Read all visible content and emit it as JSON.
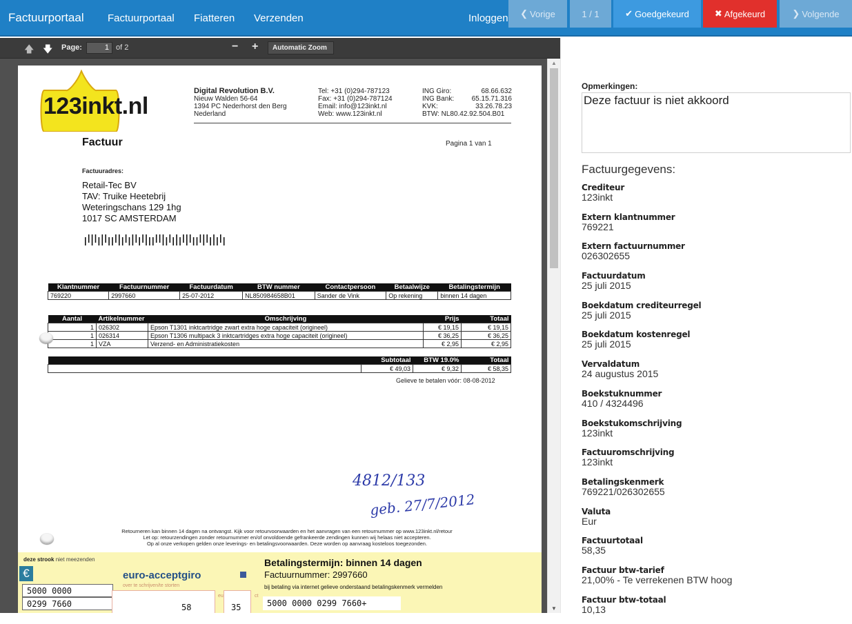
{
  "navbar": {
    "brand": "Factuurportaal",
    "links": [
      "Factuurportaal",
      "Fiatteren",
      "Verzenden"
    ],
    "login": "Inloggen",
    "prev_label": "Vorige",
    "counter": "1 / 1",
    "approved_label": "Goedgekeurd",
    "rejected_label": "Afgekeurd",
    "next_label": "Volgende",
    "colors": {
      "bar": "#1f80c6",
      "approve": "#3d9ae0",
      "reject": "#e1302c",
      "disabled": "#6da9d6"
    }
  },
  "pdf_toolbar": {
    "page_label": "Page:",
    "page_value": "1",
    "page_total": "of 2",
    "zoom_out": "−",
    "zoom_in": "+",
    "zoom_select": "Automatic Zoom"
  },
  "document": {
    "logo_text": "123inkt.nl",
    "company": {
      "name": "Digital Revolution B.V.",
      "lines": [
        "Nieuw Walden 56-64",
        "1394 PC Nederhorst den Berg",
        "Nederland"
      ]
    },
    "contact": [
      "Tel:  +31 (0)294-787123",
      "Fax: +31 (0)294-787124",
      "Email:   info@123inkt.nl",
      "Web:      www.123inkt.nl"
    ],
    "bank": [
      {
        "k": "ING Giro:",
        "v": "68.66.632"
      },
      {
        "k": "ING Bank:",
        "v": "65.15.71.316"
      },
      {
        "k": "KVK:",
        "v": "33.26.78.23"
      },
      {
        "k": "BTW: NL80.42.92.504.B01",
        "v": ""
      }
    ],
    "title": "Factuur",
    "pagina": "Pagina 1 van 1",
    "addr_label": "Factuuradres:",
    "address": [
      "Retail-Tec BV",
      "TAV: Truike Heetebrij",
      "Weteringschans 129 1hg",
      "1017 SC  AMSTERDAM"
    ],
    "info_headers": [
      "Klantnummer",
      "Factuurnummer",
      "Factuurdatum",
      "BTW nummer",
      "Contactpersoon",
      "Betaalwijze",
      "Betalingstermijn"
    ],
    "info_values": [
      "769220",
      "2997660",
      "25-07-2012",
      "NL850984658B01",
      "Sander de Vink",
      "Op rekening",
      "binnen 14 dagen"
    ],
    "item_headers": [
      "Aantal",
      "Artikelnummer",
      "Omschrijving",
      "Prijs",
      "Totaal"
    ],
    "items": [
      {
        "aantal": "1",
        "art": "026302",
        "omschr": "Epson T1301 inktcartridge zwart extra hoge capaciteit (origineel)",
        "prijs": "€ 19,15",
        "totaal": "€ 19,15"
      },
      {
        "aantal": "1",
        "art": "026314",
        "omschr": "Epson T1306 multipack 3 inktcartridges extra hoge capaciteit (origineel)",
        "prijs": "€ 36,25",
        "totaal": "€ 36,25"
      },
      {
        "aantal": "1",
        "art": "VZA",
        "omschr": "Verzend- en Administratiekosten",
        "prijs": "€ 2,95",
        "totaal": "€ 2,95"
      }
    ],
    "sum_headers": [
      "Subtotaal",
      "BTW 19.0%",
      "Totaal"
    ],
    "sum_values": [
      "€ 49,03",
      "€ 9,32",
      "€ 58,35"
    ],
    "gelieve": "Gelieve te betalen vóór:  08-08-2012",
    "handwriting_1": "4812/133",
    "handwriting_2": "geb. 27/7/2012",
    "footer_lines": [
      "Retourneren kan binnen 14 dagen na ontvangst. Kijk voor retourvoorwaarden en het aanvragen van een retournummer op www.123inkt.nl/retour",
      "Let op: retourzendingen zonder retournummer en/of onvoldoende gefrankeerde zendingen kunnen wij helaas niet accepteren.",
      "Op al onze verkopen gelden onze leverings- en betalingsvoorwaarden. Deze worden op aanvraag kosteloos toegezonden."
    ],
    "strip": {
      "note_bold": "deze strook",
      "note_rest": " niet meezenden",
      "euro": "€",
      "acceptgiro_title": "euro-acceptgiro",
      "acceptgiro_sub": "over te schrijven/te storten",
      "box1": "5000 0000",
      "box2": "0299 7660",
      "amount_euro": "58",
      "amount_cents": "35",
      "euro_label": "euro",
      "ct_label": "ct",
      "bt_title": "Betalingstermijn: binnen 14 dagen",
      "bt_num": "Factuurnummer: 2997660",
      "bt_small": "bij betaling via internet gelieve onderstaand betalingskenmerk vermelden",
      "bt_kenmerk": "5000 0000 0299 7660+"
    }
  },
  "panel": {
    "remarks_label": "Opmerkingen:",
    "remarks_value": "Deze factuur is niet akkoord",
    "section_title": "Factuurgegevens:",
    "fields": [
      {
        "k": "Crediteur",
        "v": "123inkt"
      },
      {
        "k": "Extern klantnummer",
        "v": "769221"
      },
      {
        "k": "Extern factuurnummer",
        "v": "026302655"
      },
      {
        "k": "Factuurdatum",
        "v": "25 juli 2015"
      },
      {
        "k": "Boekdatum crediteurregel",
        "v": "25 juli 2015"
      },
      {
        "k": "Boekdatum kostenregel",
        "v": "25 juli 2015"
      },
      {
        "k": "Vervaldatum",
        "v": "24 augustus 2015"
      },
      {
        "k": "Boekstuknummer",
        "v": "410 / 4324496"
      },
      {
        "k": "Boekstukomschrijving",
        "v": "123inkt"
      },
      {
        "k": "Factuuromschrijving",
        "v": "123inkt"
      },
      {
        "k": "Betalingskenmerk",
        "v": "769221/026302655"
      },
      {
        "k": "Valuta",
        "v": "Eur"
      },
      {
        "k": "Factuurtotaal",
        "v": "58,35"
      },
      {
        "k": "Factuur btw-tarief",
        "v": "21,00% -  Te verrekenen BTW hoog"
      },
      {
        "k": "Factuur btw-totaal",
        "v": "10,13"
      }
    ]
  }
}
